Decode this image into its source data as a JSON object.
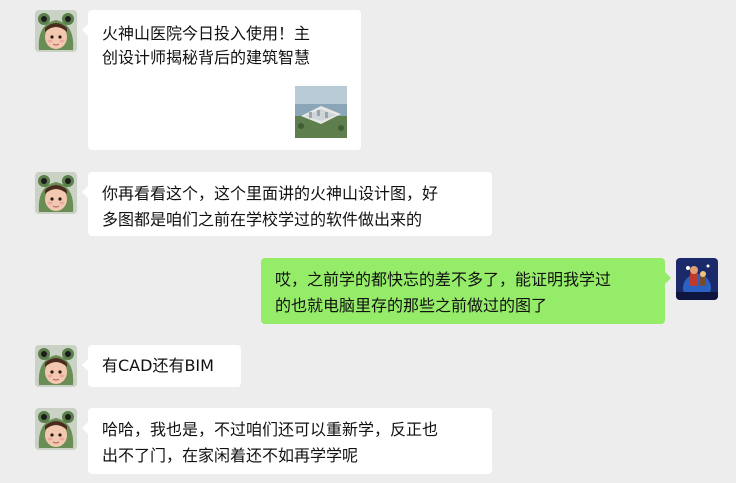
{
  "messages": [
    {
      "side": "left",
      "type": "link",
      "title_lines": [
        "火神山医院今日投入使用！主",
        "创设计师揭秘背后的建筑智慧"
      ],
      "thumbnail": "building-render-thumbnail"
    },
    {
      "side": "left",
      "type": "text",
      "lines": [
        "你再看看这个，这个里面讲的火神山设计图，好",
        "多图都是咱们之前在学校学过的软件做出来的"
      ]
    },
    {
      "side": "right",
      "type": "text",
      "lines": [
        "哎，之前学的都快忘的差不多了，能证明我学过",
        "的也就电脑里存的那些之前做过的图了"
      ]
    },
    {
      "side": "left",
      "type": "text",
      "lines": [
        "有CAD还有BIM"
      ]
    },
    {
      "side": "left",
      "type": "text",
      "lines": [
        "哈哈，我也是，不过咱们还可以重新学，反正也",
        "出不了门，在家闲着还不如再学学呢"
      ]
    }
  ],
  "colors": {
    "background": "#ededed",
    "incoming_bubble": "#ffffff",
    "outgoing_bubble": "#95ec69",
    "text": "#111111"
  },
  "icons": {
    "contact_avatar": "girl-frog-hat-avatar",
    "self_avatar": "movie-poster-avatar"
  }
}
